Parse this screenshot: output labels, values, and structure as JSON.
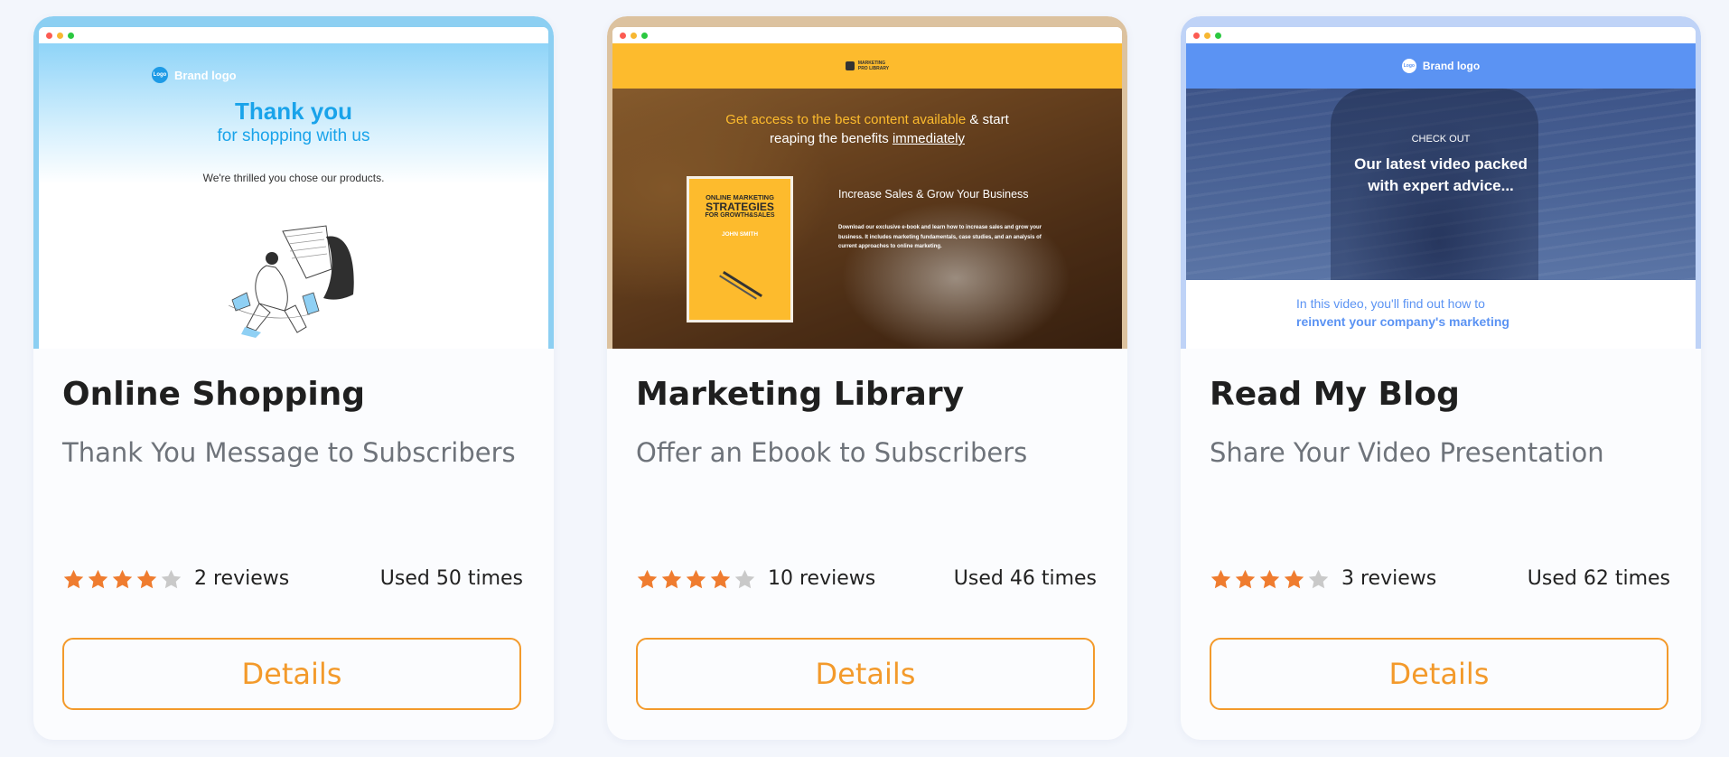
{
  "colors": {
    "accent": "#f39a2b",
    "star_filled": "#ef7c2f",
    "star_empty": "#c9c9c9"
  },
  "cards": [
    {
      "title": "Online Shopping",
      "subtitle": "Thank You Message to Subscribers",
      "rating": 4,
      "reviews": "2 reviews",
      "used": "Used 50 times",
      "button": "Details",
      "preview": {
        "logo": "Logo",
        "brand": "Brand logo",
        "heading": "Thank you",
        "subheading": "for shopping with us",
        "text": "We're thrilled you chose our products."
      }
    },
    {
      "title": "Marketing Library",
      "subtitle": "Offer an Ebook to Subscribers",
      "rating": 4,
      "reviews": "10 reviews",
      "used": "Used 46 times",
      "button": "Details",
      "preview": {
        "brand_small": "MARKETING",
        "brand": "PRO LIBRARY",
        "headline_highlight": "Get access to the best content available",
        "headline_rest": " & start",
        "headline_line2": "reaping the benefits ",
        "headline_underlined": "immediately",
        "book_line1": "ONLINE MARKETING",
        "book_line2": "STRATEGIES",
        "book_line3": "FOR GROWTH&SALES",
        "book_author": "JOHN SMITH",
        "side_heading": "Increase Sales & Grow Your Business",
        "side_text": "Download our exclusive e-book and learn how to increase sales and grow your business. It includes marketing fundamentals, case studies, and an analysis of current approaches to online marketing."
      }
    },
    {
      "title": "Read My Blog",
      "subtitle": "Share Your Video Presentation",
      "rating": 4,
      "reviews": "3 reviews",
      "used": "Used 62 times",
      "button": "Details",
      "preview": {
        "logo": "Logo",
        "brand": "Brand logo",
        "kicker": "CHECK OUT",
        "heading_line1": "Our latest video packed",
        "heading_line2": "with expert advice...",
        "text_line1": "In this video, you'll find out how to",
        "text_line2": "reinvent your company's marketing"
      }
    }
  ]
}
